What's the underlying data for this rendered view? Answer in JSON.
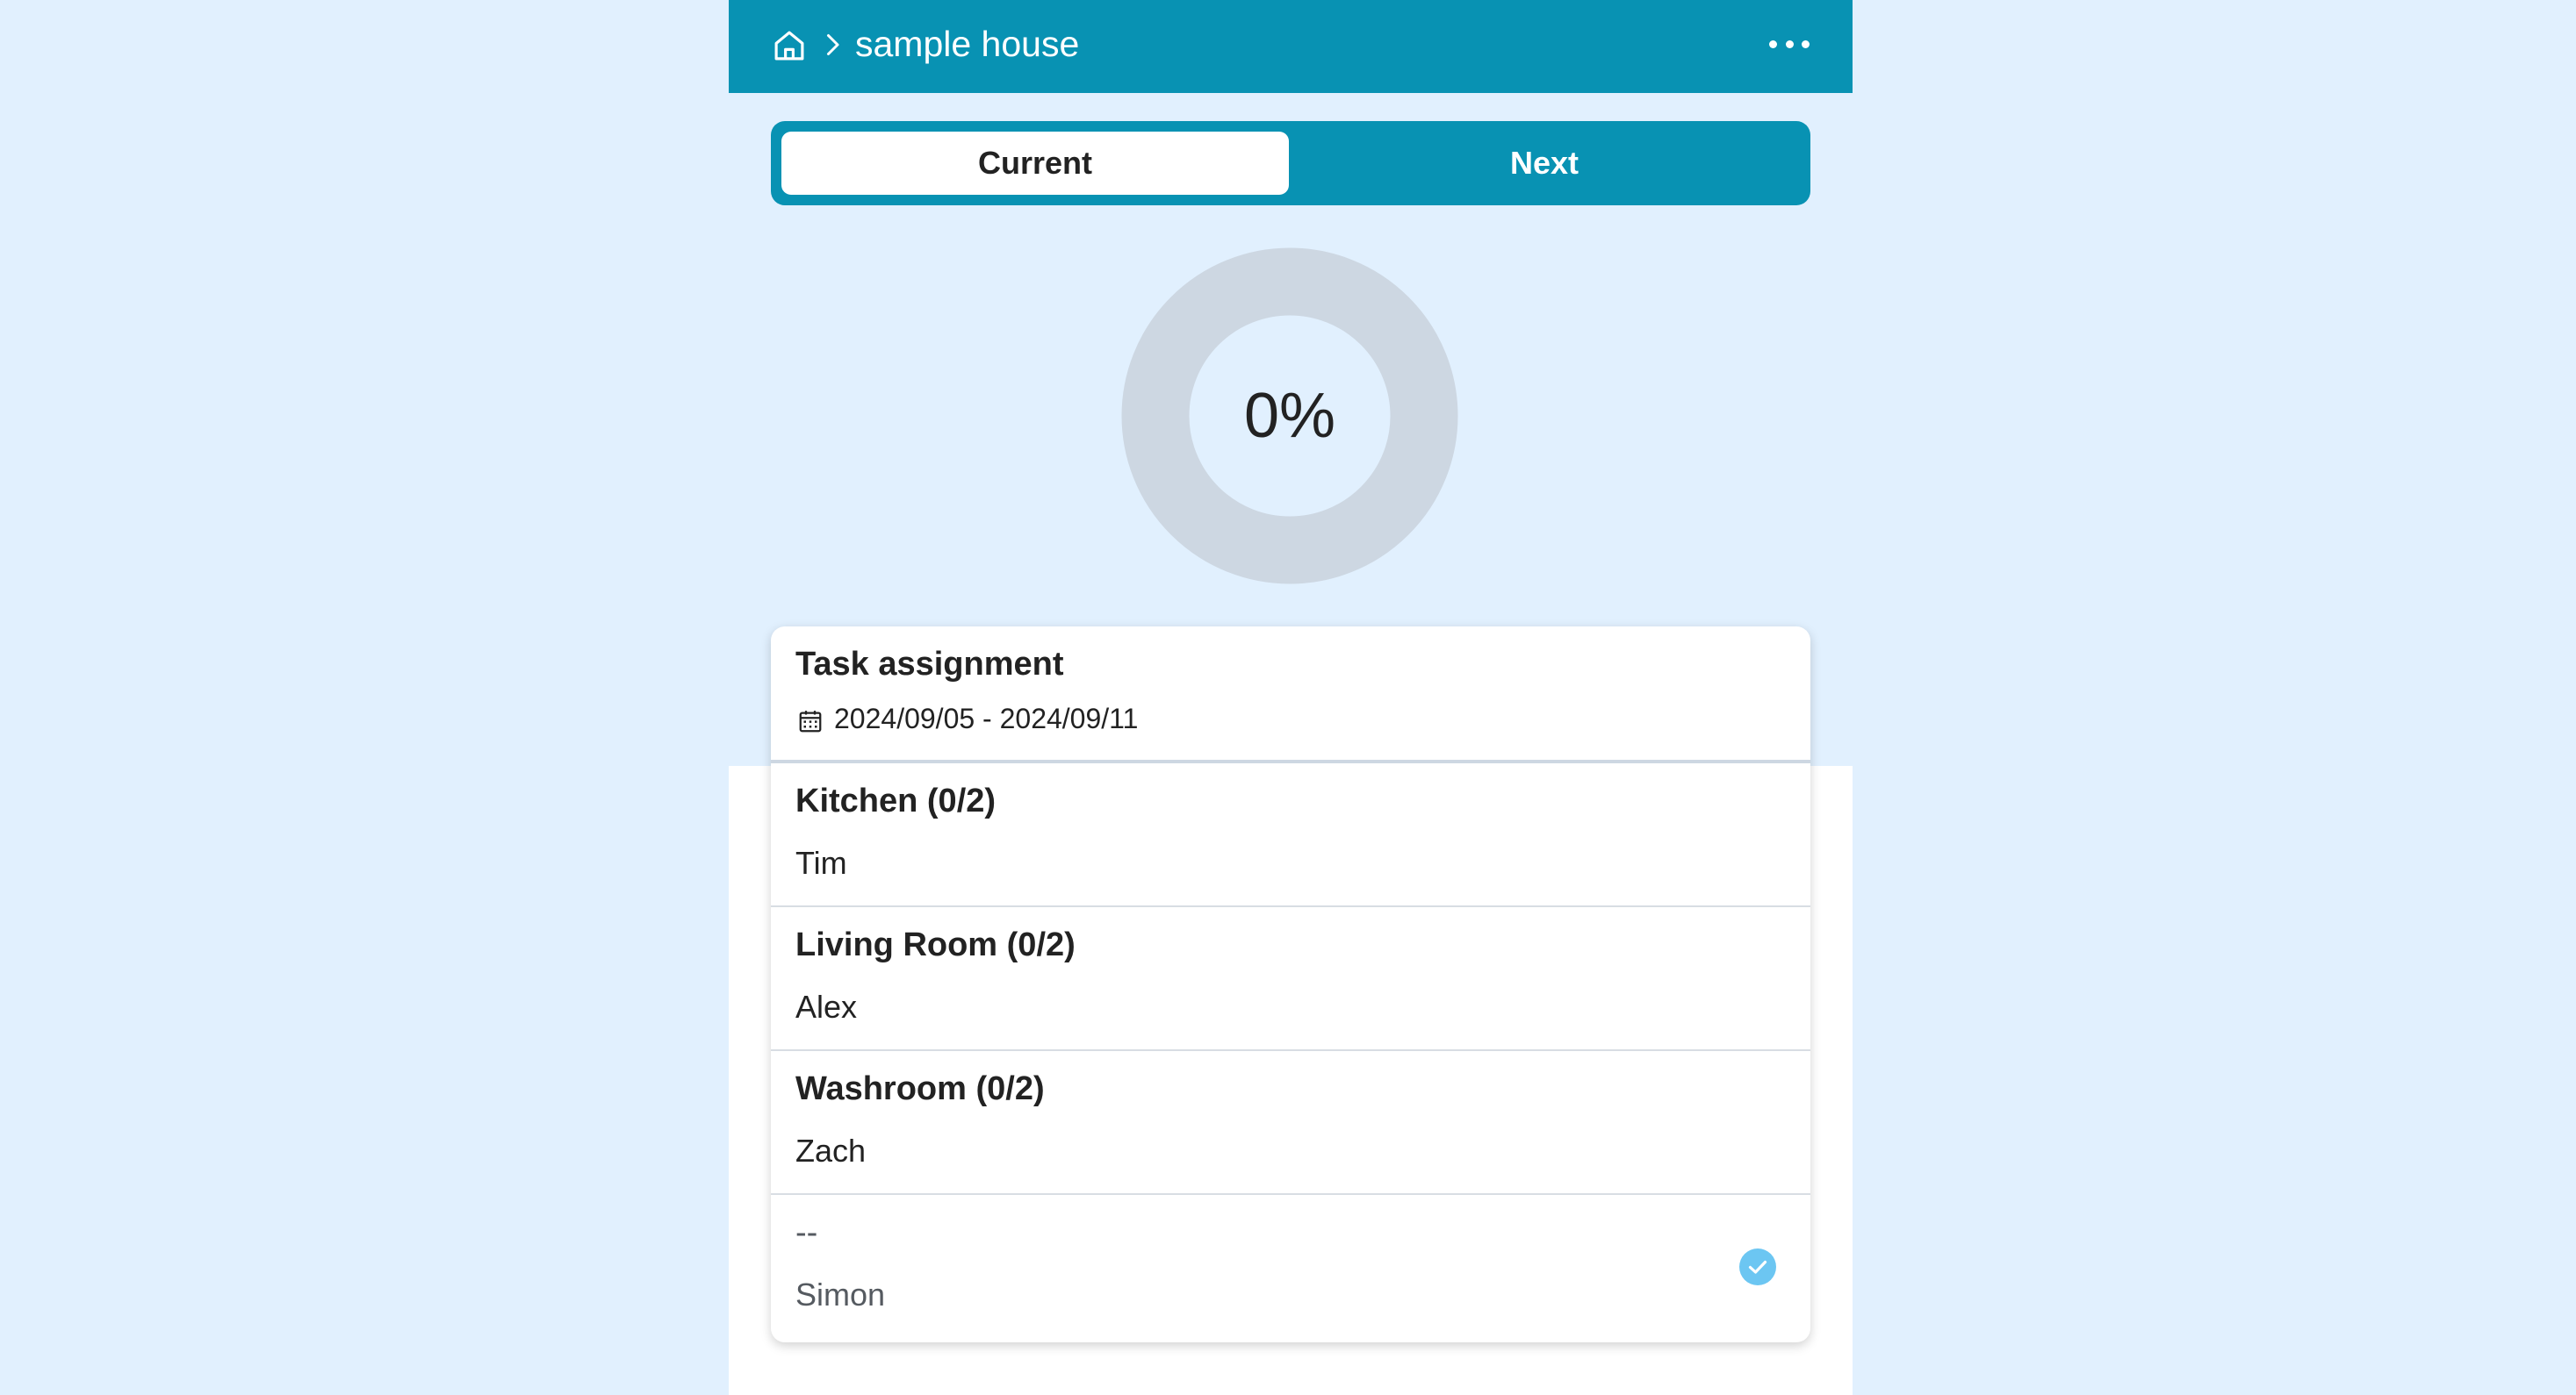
{
  "header": {
    "house_name": "sample house",
    "icons": [
      "home-icon",
      "chevron-right-icon",
      "more-horizontal-icon"
    ],
    "bar_color": "#0892b3"
  },
  "tabs": {
    "current_label": "Current",
    "next_label": "Next",
    "selected": "Current"
  },
  "progress": {
    "label": "0%",
    "value": 0,
    "track_color": "#cdd7e2"
  },
  "task_card": {
    "title": "Task assignment",
    "date_range": "2024/09/05 - 2024/09/11",
    "icon": "calendar-icon",
    "tasks": [
      {
        "name": "Kitchen (0/2)",
        "assignee": "Tim",
        "done": false
      },
      {
        "name": "Living Room (0/2)",
        "assignee": "Alex",
        "done": false
      },
      {
        "name": "Washroom (0/2)",
        "assignee": "Zach",
        "done": false
      },
      {
        "name": "--",
        "assignee": "Simon",
        "done": true
      }
    ]
  },
  "colors": {
    "page_background": "#e1f0fe",
    "accent": "#0892b3",
    "check": "#6cc6f2"
  }
}
